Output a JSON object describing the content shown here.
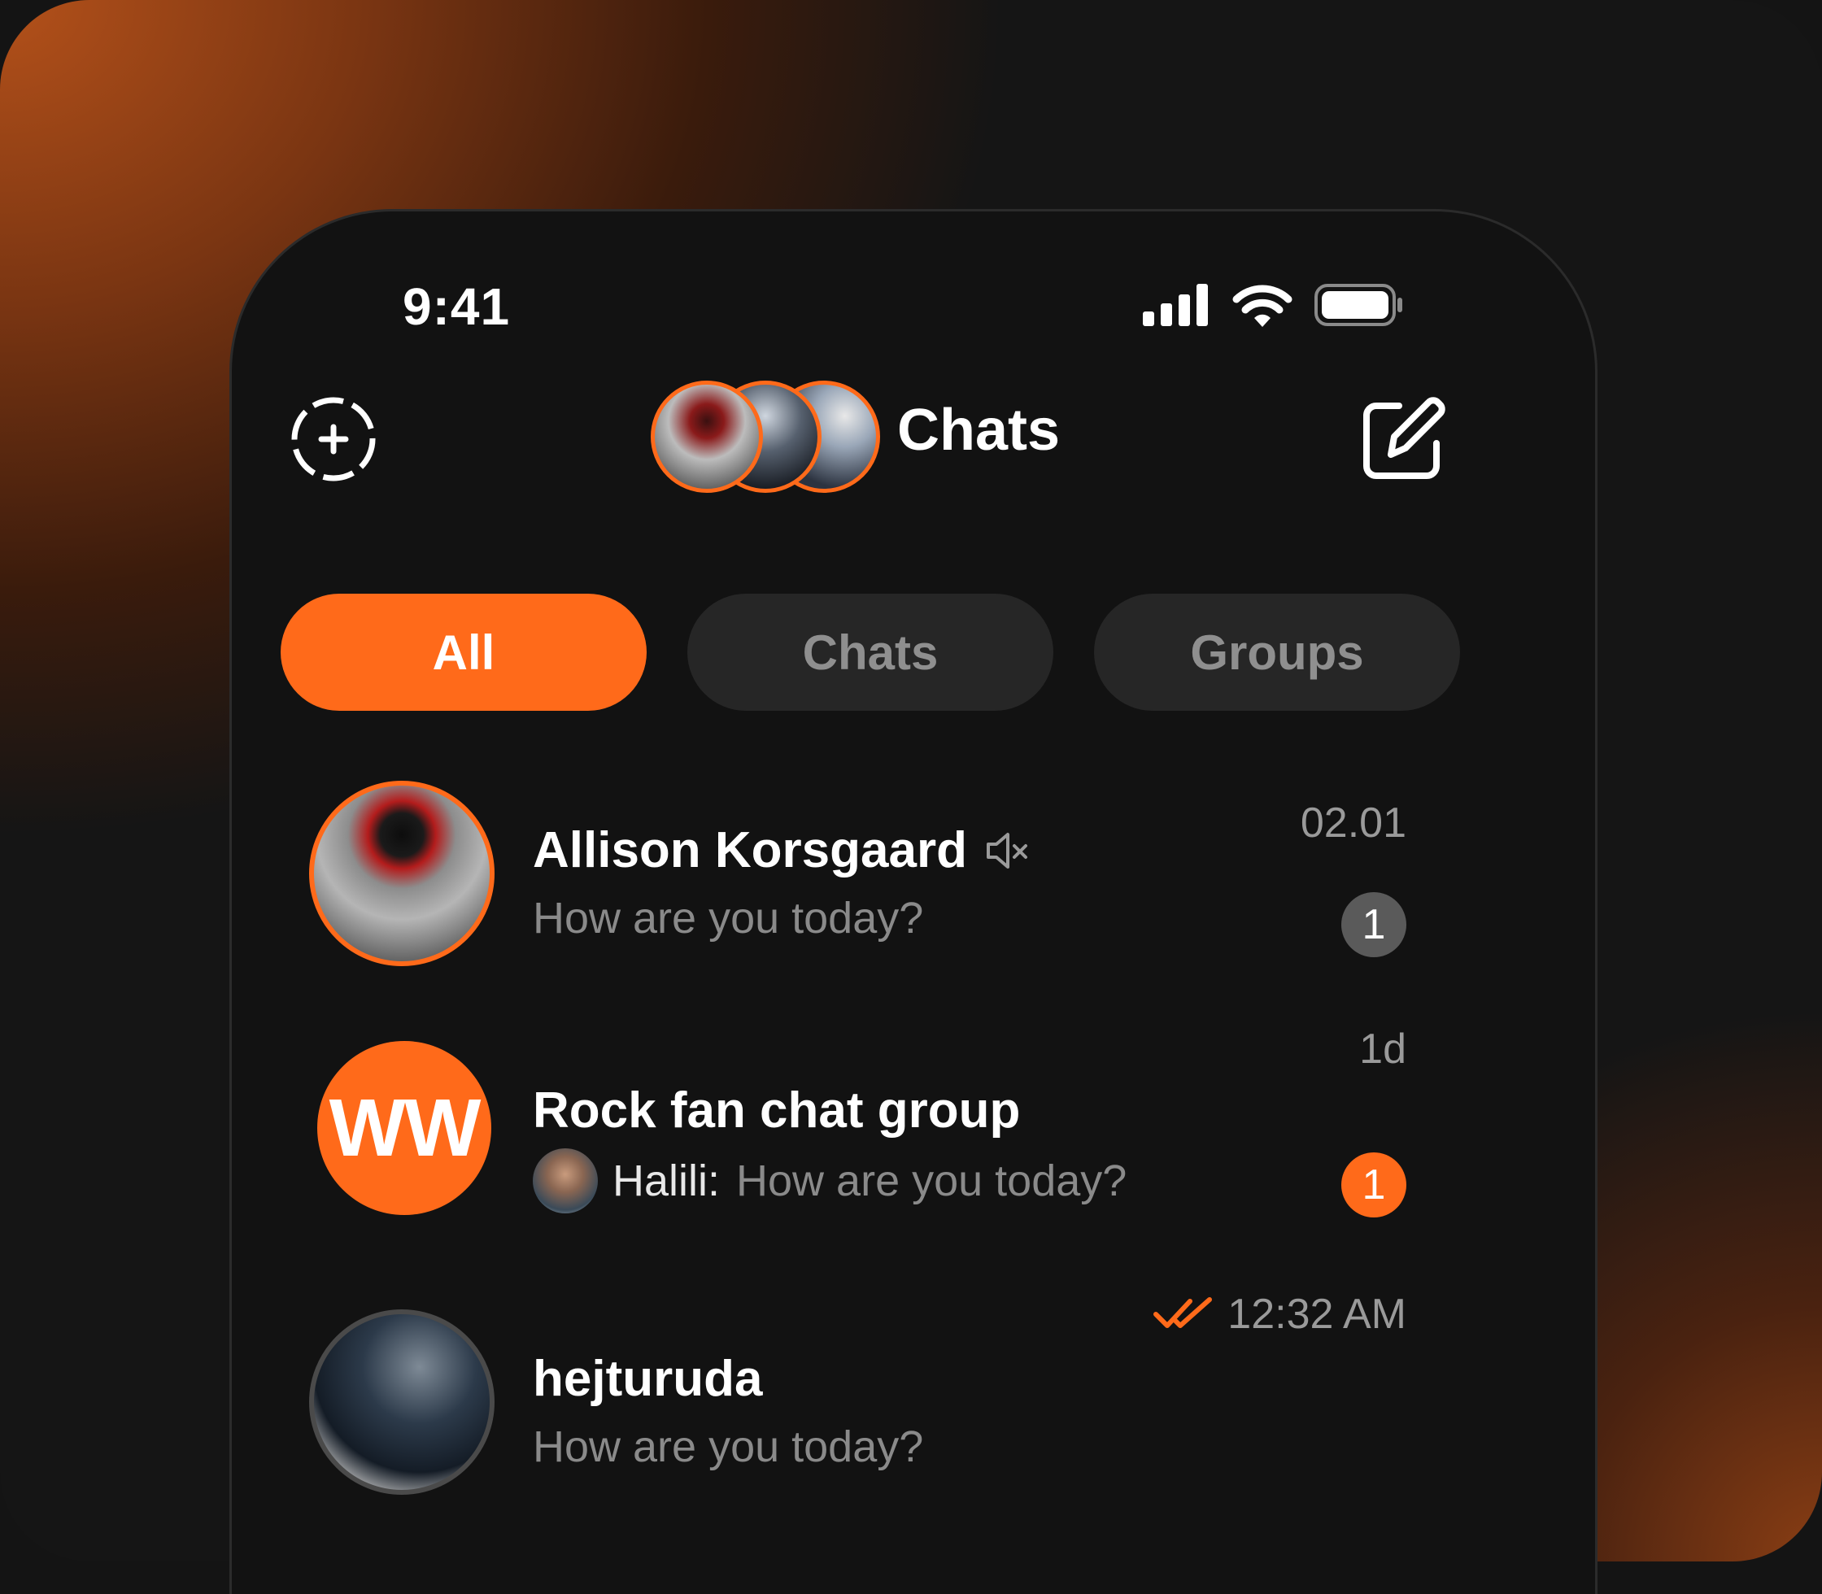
{
  "status_bar": {
    "time": "9:41"
  },
  "header": {
    "title": "Chats",
    "add_story_icon": "dashed-circle-plus-icon",
    "compose_icon": "compose-icon"
  },
  "tabs": [
    {
      "label": "All",
      "active": true
    },
    {
      "label": "Chats",
      "active": false
    },
    {
      "label": "Groups",
      "active": false
    }
  ],
  "chats": [
    {
      "name": "Allison Korsgaard",
      "muted": true,
      "preview": "How are you today?",
      "time": "02.01",
      "unread": "1",
      "badge_color": "#5a5a5a"
    },
    {
      "name": "Rock fan chat group",
      "avatar_initials": "WW",
      "sender": "Halili:",
      "preview": "How are you today?",
      "time": "1d",
      "unread": "1",
      "badge_color": "#ff6a1a"
    },
    {
      "name": "hejturuda",
      "preview": "How are you today?",
      "time": "12:32 AM",
      "read_receipt": "double-check-icon"
    }
  ],
  "colors": {
    "accent": "#ff6a1a",
    "background": "#121212",
    "tab_inactive": "#262626"
  }
}
